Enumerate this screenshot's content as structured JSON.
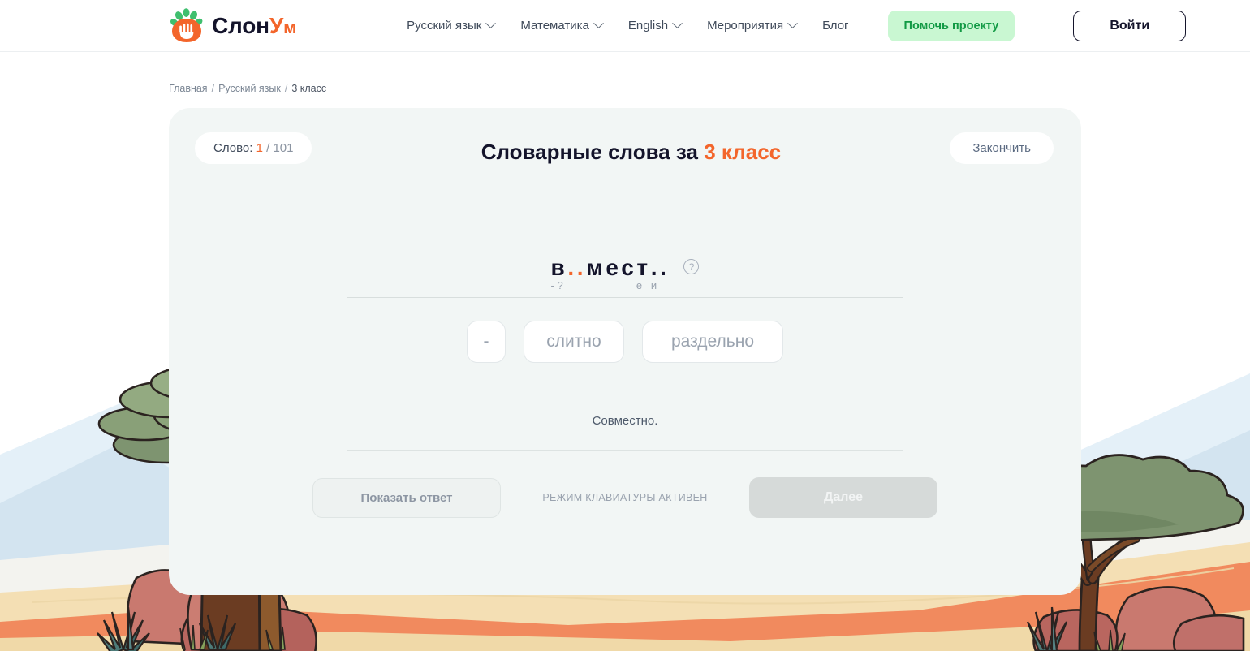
{
  "header": {
    "logo": {
      "icon": "paw-leaf-logo-icon",
      "text_dark": "Слон",
      "text_accent_u": "У",
      "text_accent_m": "м"
    },
    "nav": [
      {
        "label": "Русский язык",
        "has_chevron": true
      },
      {
        "label": "Математика",
        "has_chevron": true
      },
      {
        "label": "English",
        "has_chevron": true
      },
      {
        "label": "Мероприятия",
        "has_chevron": true
      },
      {
        "label": "Блог",
        "has_chevron": false
      }
    ],
    "support_button": "Помочь проекту",
    "login_button": "Войти"
  },
  "breadcrumb": {
    "home": "Главная",
    "sep1": "/",
    "subject": "Русский язык",
    "sep2": "/",
    "current": "3 класс"
  },
  "card": {
    "counter": {
      "label": "Слово:",
      "current": "1",
      "slash": "/",
      "total": "101"
    },
    "title_prefix": "Словарные слова за",
    "title_grade": "3 класс",
    "finish_button": "Закончить",
    "puzzle": {
      "prefix": "в",
      "gap_active": "..",
      "middle": "мест",
      "gap_end": "..",
      "hints_line": "-?            е и",
      "help_icon_glyph": "?"
    },
    "options": [
      {
        "label": "-",
        "width": "w1"
      },
      {
        "label": "слитно",
        "width": "w2"
      },
      {
        "label": "раздельно",
        "width": "w3"
      }
    ],
    "definition": "Совместно.",
    "show_answer_button": "Показать ответ",
    "keyboard_mode_label": "Режим клавиатуры активен",
    "next_button": "Далее"
  },
  "colors": {
    "accent_orange": "#f3652b",
    "dark_text": "#14142b",
    "card_bg": "#f2f6f5",
    "support_green_bg": "#c9f7d2",
    "support_green_text": "#129a45",
    "muted_grey": "#9aa3af"
  }
}
